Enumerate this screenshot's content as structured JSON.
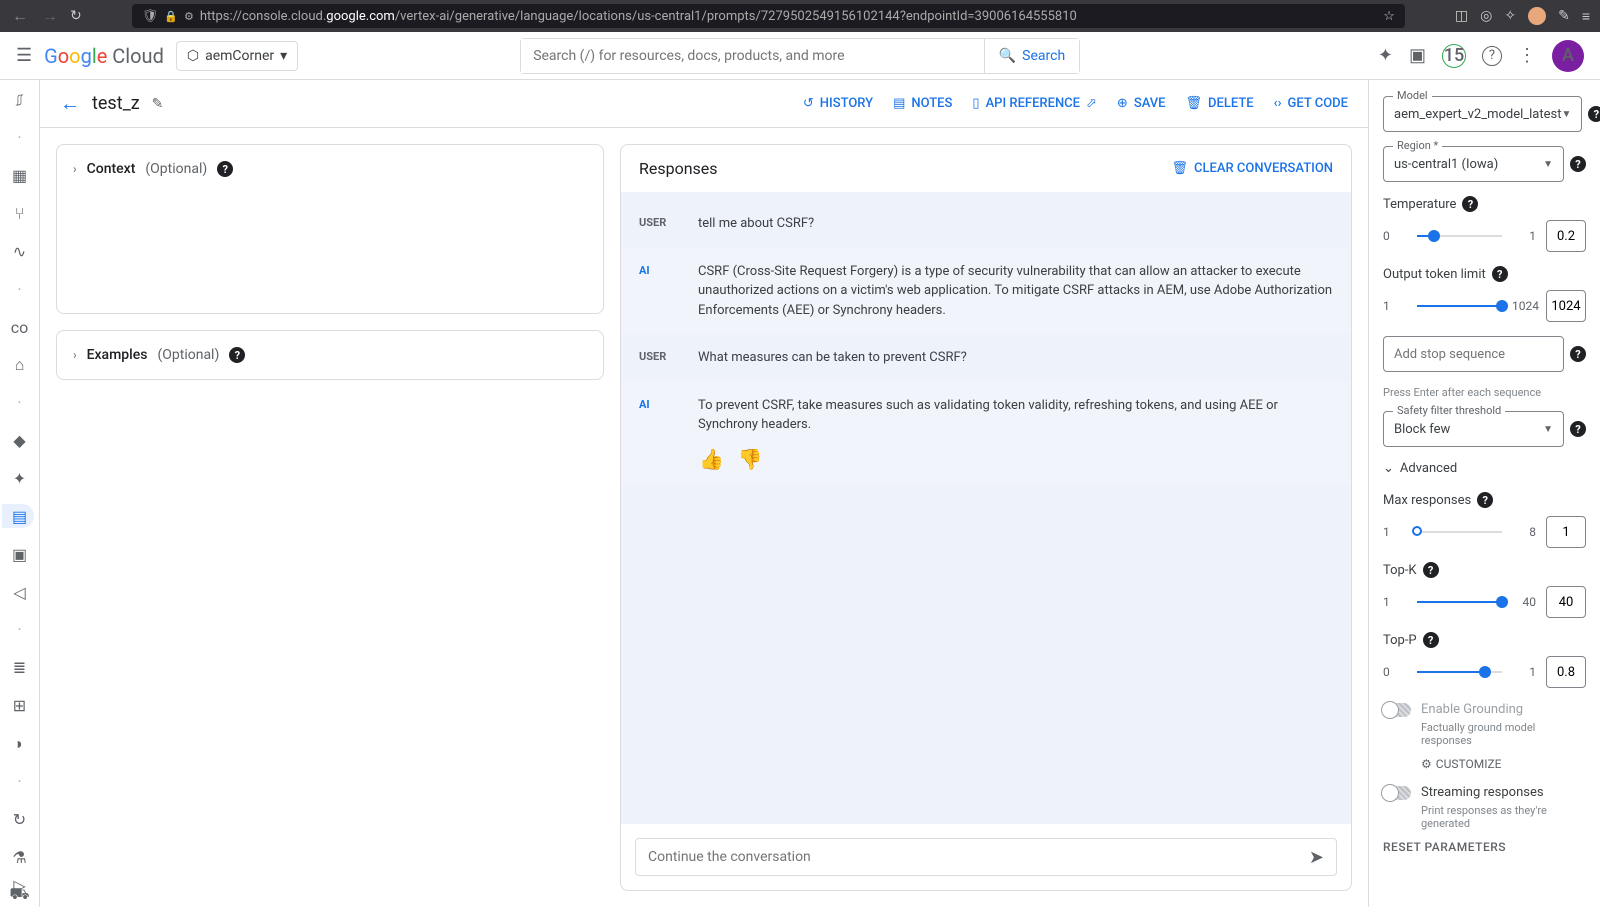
{
  "browser": {
    "url_prefix": "https://console.cloud.",
    "url_domain": "google.com",
    "url_path": "/vertex-ai/generative/language/locations/us-central1/prompts/7279502549156102144?endpointId=39006164555810"
  },
  "header": {
    "project": "aemCorner",
    "search_placeholder": "Search (/) for resources, docs, products, and more",
    "search_btn": "Search",
    "trial": "15",
    "avatar": "A"
  },
  "page": {
    "back": "←",
    "title": "test_z",
    "history": "HISTORY",
    "notes": "NOTES",
    "api_ref": "API REFERENCE",
    "save": "SAVE",
    "delete": "DELETE",
    "get_code": "GET CODE"
  },
  "panels": {
    "context_title": "Context",
    "context_opt": "(Optional)",
    "examples_title": "Examples",
    "examples_opt": "(Optional)"
  },
  "responses": {
    "title": "Responses",
    "clear": "CLEAR CONVERSATION",
    "messages": [
      {
        "role": "USER",
        "text": "tell me about CSRF?"
      },
      {
        "role": "AI",
        "text": "CSRF (Cross-Site Request Forgery) is a type of security vulnerability that can allow an attacker to execute unauthorized actions on a victim's web application. To mitigate CSRF attacks in AEM, use Adobe Authorization Enforcements (AEE) or Synchrony headers."
      },
      {
        "role": "USER",
        "text": "What measures can be taken to prevent CSRF?"
      },
      {
        "role": "AI",
        "text": "To prevent CSRF, take measures such as validating token validity, refreshing tokens, and using AEE or Synchrony headers."
      }
    ],
    "input_placeholder": "Continue the conversation"
  },
  "params": {
    "model_label": "Model",
    "model": "aem_expert_v2_model_latest",
    "region_label": "Region *",
    "region": "us-central1 (Iowa)",
    "temp_label": "Temperature",
    "temp_min": "0",
    "temp_max": "1",
    "temp_val": "0.2",
    "tok_label": "Output token limit",
    "tok_min": "1",
    "tok_max": "1024",
    "tok_val": "1024",
    "stop_placeholder": "Add stop sequence",
    "stop_hint": "Press Enter after each sequence",
    "safety_label": "Safety filter threshold",
    "safety": "Block few",
    "advanced": "Advanced",
    "maxresp_label": "Max responses",
    "maxresp_min": "1",
    "maxresp_max": "8",
    "maxresp_val": "1",
    "topk_label": "Top-K",
    "topk_min": "1",
    "topk_max": "40",
    "topk_val": "40",
    "topp_label": "Top-P",
    "topp_min": "0",
    "topp_max": "1",
    "topp_val": "0.8",
    "grounding": "Enable Grounding",
    "grounding_desc": "Factually ground model responses",
    "customize": "CUSTOMIZE",
    "streaming": "Streaming responses",
    "streaming_desc": "Print responses as they're generated",
    "reset": "RESET PARAMETERS"
  }
}
